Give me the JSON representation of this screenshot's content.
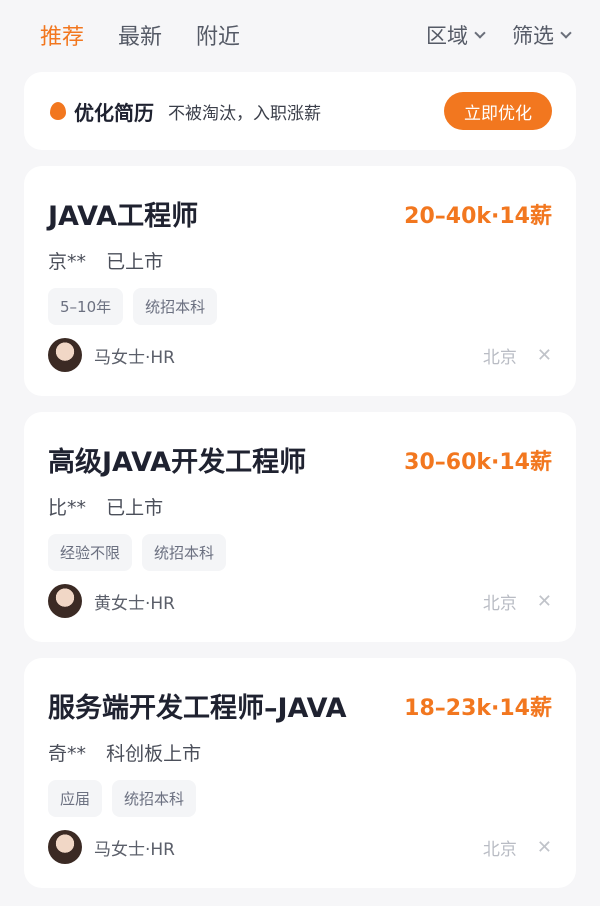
{
  "tabs": {
    "recommend": "推荐",
    "latest": "最新",
    "nearby": "附近"
  },
  "filters": {
    "region": "区域",
    "screen": "筛选"
  },
  "promo": {
    "title": "优化简历",
    "subtitle": "不被淘汰，入职涨薪",
    "button": "立即优化"
  },
  "jobs": [
    {
      "title": "JAVA工程师",
      "salary": "20–40k·14薪",
      "company": "京**",
      "status": "已上市",
      "tags": [
        "5–10年",
        "统招本科"
      ],
      "hr": "马女士·HR",
      "city": "北京"
    },
    {
      "title": "高级JAVA开发工程师",
      "salary": "30–60k·14薪",
      "company": "比**",
      "status": "已上市",
      "tags": [
        "经验不限",
        "统招本科"
      ],
      "hr": "黄女士·HR",
      "city": "北京"
    },
    {
      "title": "服务端开发工程师–JAVA",
      "salary": "18–23k·14薪",
      "company": "奇**",
      "status": "科创板上市",
      "tags": [
        "应届",
        "统招本科"
      ],
      "hr": "马女士·HR",
      "city": "北京"
    }
  ],
  "colors": {
    "accent": "#f2771f",
    "background": "#f6f6f8"
  },
  "icons": {
    "close": "close-icon",
    "dropdown": "chevron-down-icon",
    "promo": "flame-icon"
  }
}
